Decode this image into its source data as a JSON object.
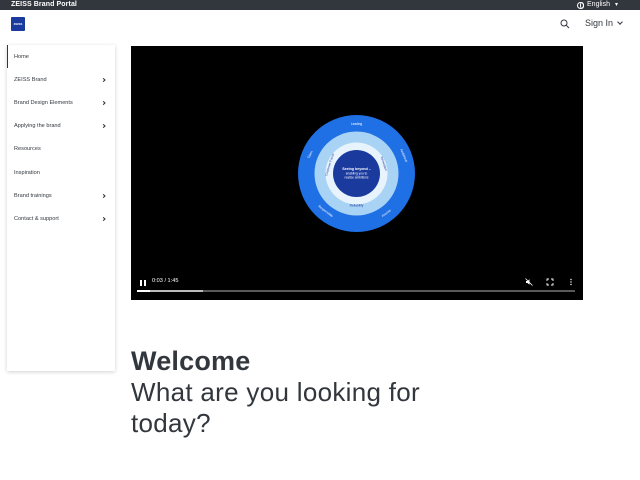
{
  "topbar": {
    "brand": "ZEISS Brand Portal",
    "language": "English",
    "globe_icon": "globe-icon"
  },
  "header": {
    "logo_text": "ZEISS",
    "search_icon": "search-icon",
    "signin_label": "Sign In"
  },
  "sidebar": {
    "items": [
      {
        "label": "Home",
        "has_children": false,
        "active": true
      },
      {
        "label": "ZEISS Brand",
        "has_children": true,
        "active": false
      },
      {
        "label": "Brand Design Elements",
        "has_children": true,
        "active": false
      },
      {
        "label": "Applying the brand",
        "has_children": true,
        "active": false
      },
      {
        "label": "Resources",
        "has_children": false,
        "active": false
      },
      {
        "label": "Inspiration",
        "has_children": false,
        "active": false
      },
      {
        "label": "Brand trainings",
        "has_children": true,
        "active": false
      },
      {
        "label": "Contact & support",
        "has_children": true,
        "active": false
      }
    ]
  },
  "video": {
    "time": "0:03 / 1:45",
    "played_fraction": 0.03,
    "buffered_fraction": 0.15,
    "diagram": {
      "center_title": "Seeing beyond –",
      "center_text_1": "enabling you to",
      "center_text_2": "realize ambitions",
      "ring_mid": [
        "Customer Focus",
        "Innovation",
        "Reliability"
      ],
      "ring_outer": [
        "Leading",
        "Open",
        "Ambitious",
        "Responsible",
        "Precise"
      ]
    },
    "colors": {
      "outer_ring": "#1f6fe5",
      "mid_ring": "#a9d3f5",
      "inner_gap": "#e8f4fd",
      "core": "#1a3a9e"
    }
  },
  "hero": {
    "welcome": "Welcome",
    "subtitle": "What are you looking for today?"
  },
  "colors": {
    "text": "#32373e",
    "topbar_bg": "#32373e",
    "brand_blue": "#1a3a9e"
  }
}
